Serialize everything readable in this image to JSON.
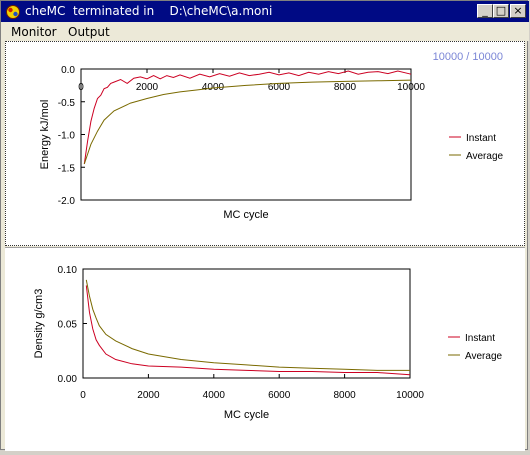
{
  "window": {
    "title": "cheMC  terminated in    D:\\cheMC\\a.moni",
    "controls": [
      "_",
      "□",
      "×"
    ]
  },
  "menu": {
    "items": [
      "Monitor",
      "Output"
    ]
  },
  "progress_text": "10000 /  10000",
  "colors": {
    "instant": "#cc0022",
    "average": "#7a6a00",
    "title_bar": "#000a84",
    "progress": "#7b86d6"
  },
  "chart_data": [
    {
      "type": "line",
      "ylabel": "Energy kJ/mol",
      "xlabel": "MC cycle",
      "xlim": [
        0,
        10000
      ],
      "ylim": [
        -2.0,
        0.0
      ],
      "x_ticks": [
        "0",
        "2000",
        "4000",
        "6000",
        "8000",
        "10000"
      ],
      "y_ticks": [
        "0.0",
        "-0.5",
        "-1.0",
        "-1.5",
        "-2.0"
      ],
      "legend": "right",
      "series": [
        {
          "name": "Instant",
          "x": [
            100,
            200,
            300,
            400,
            500,
            600,
            700,
            800,
            900,
            1000,
            1200,
            1400,
            1600,
            1800,
            2000,
            2200,
            2400,
            2600,
            2800,
            3000,
            3300,
            3600,
            3900,
            4200,
            4500,
            4800,
            5100,
            5400,
            5700,
            6000,
            6300,
            6600,
            6900,
            7200,
            7500,
            7800,
            8100,
            8400,
            8700,
            9000,
            9300,
            9600,
            10000
          ],
          "y": [
            -1.45,
            -1.1,
            -0.8,
            -0.6,
            -0.45,
            -0.4,
            -0.3,
            -0.28,
            -0.22,
            -0.2,
            -0.16,
            -0.22,
            -0.14,
            -0.12,
            -0.15,
            -0.1,
            -0.15,
            -0.1,
            -0.13,
            -0.09,
            -0.14,
            -0.08,
            -0.12,
            -0.07,
            -0.11,
            -0.06,
            -0.1,
            -0.08,
            -0.05,
            -0.09,
            -0.06,
            -0.1,
            -0.05,
            -0.08,
            -0.04,
            -0.07,
            -0.03,
            -0.08,
            -0.05,
            -0.04,
            -0.07,
            -0.03,
            -0.08
          ]
        },
        {
          "name": "Average",
          "x": [
            100,
            300,
            500,
            700,
            1000,
            1500,
            2000,
            2500,
            3000,
            3500,
            4000,
            5000,
            6000,
            7000,
            8000,
            9000,
            10000
          ],
          "y": [
            -1.45,
            -1.15,
            -0.95,
            -0.78,
            -0.64,
            -0.52,
            -0.45,
            -0.39,
            -0.35,
            -0.32,
            -0.29,
            -0.25,
            -0.22,
            -0.2,
            -0.19,
            -0.18,
            -0.17
          ]
        }
      ]
    },
    {
      "type": "line",
      "ylabel": "Density g/cm3",
      "xlabel": "MC cycle",
      "xlim": [
        0,
        10000
      ],
      "ylim": [
        0.0,
        0.1
      ],
      "x_ticks": [
        "0",
        "2000",
        "4000",
        "6000",
        "8000",
        "10000"
      ],
      "y_ticks": [
        "0.10",
        "0.05",
        "0.00"
      ],
      "legend": "right",
      "series": [
        {
          "name": "Instant",
          "x": [
            100,
            200,
            300,
            400,
            500,
            700,
            1000,
            1500,
            2000,
            3000,
            4000,
            5000,
            6000,
            7000,
            8000,
            9000,
            10000
          ],
          "y": [
            0.085,
            0.06,
            0.045,
            0.035,
            0.03,
            0.022,
            0.017,
            0.013,
            0.011,
            0.01,
            0.008,
            0.007,
            0.006,
            0.006,
            0.005,
            0.005,
            0.003
          ]
        },
        {
          "name": "Average",
          "x": [
            100,
            200,
            300,
            400,
            500,
            700,
            1000,
            1500,
            2000,
            3000,
            4000,
            5000,
            6000,
            7000,
            8000,
            9000,
            10000
          ],
          "y": [
            0.09,
            0.075,
            0.063,
            0.055,
            0.048,
            0.04,
            0.034,
            0.027,
            0.022,
            0.017,
            0.014,
            0.012,
            0.01,
            0.009,
            0.008,
            0.007,
            0.007
          ]
        }
      ]
    }
  ]
}
